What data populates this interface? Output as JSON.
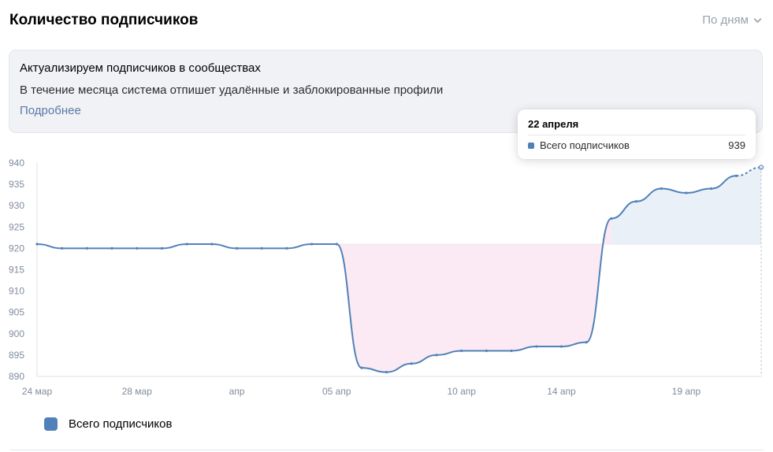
{
  "header": {
    "title": "Количество подписчиков",
    "period_label": "По дням"
  },
  "notice": {
    "title": "Актуализируем подписчиков в сообществах",
    "text": "В течение месяца система отпишет удалённые и заблокированные профили",
    "link": "Подробнее"
  },
  "tooltip": {
    "date": "22 апреля",
    "series_label": "Всего подписчиков",
    "value": "939"
  },
  "legend": {
    "label": "Всего подписчиков"
  },
  "colors": {
    "series": "#5181b8",
    "gain_fill": "#eaf0f8",
    "loss_fill": "#fbe9f3"
  },
  "chart_data": {
    "type": "line",
    "yticks": [
      890,
      895,
      900,
      905,
      910,
      915,
      920,
      925,
      930,
      935,
      940
    ],
    "ylim": [
      890,
      940
    ],
    "xticks": [
      {
        "label": "24 мар",
        "day": 0
      },
      {
        "label": "28 мар",
        "day": 4
      },
      {
        "label": "апр",
        "day": 8
      },
      {
        "label": "05 апр",
        "day": 12
      },
      {
        "label": "10 апр",
        "day": 17
      },
      {
        "label": "14 апр",
        "day": 21
      },
      {
        "label": "19 апр",
        "day": 26
      }
    ],
    "baseline": 921,
    "series": [
      {
        "name": "Всего подписчиков",
        "x": [
          0,
          1,
          2,
          3,
          4,
          5,
          6,
          7,
          8,
          9,
          10,
          11,
          12,
          13,
          14,
          15,
          16,
          17,
          18,
          19,
          20,
          21,
          22,
          23,
          24,
          25,
          26,
          27,
          28,
          29
        ],
        "values": [
          921,
          920,
          920,
          920,
          920,
          920,
          921,
          921,
          920,
          920,
          920,
          921,
          921,
          892,
          891,
          893,
          895,
          896,
          896,
          896,
          897,
          897,
          898,
          927,
          931,
          934,
          933,
          934,
          937,
          939
        ],
        "dashed_from": 28
      }
    ]
  }
}
